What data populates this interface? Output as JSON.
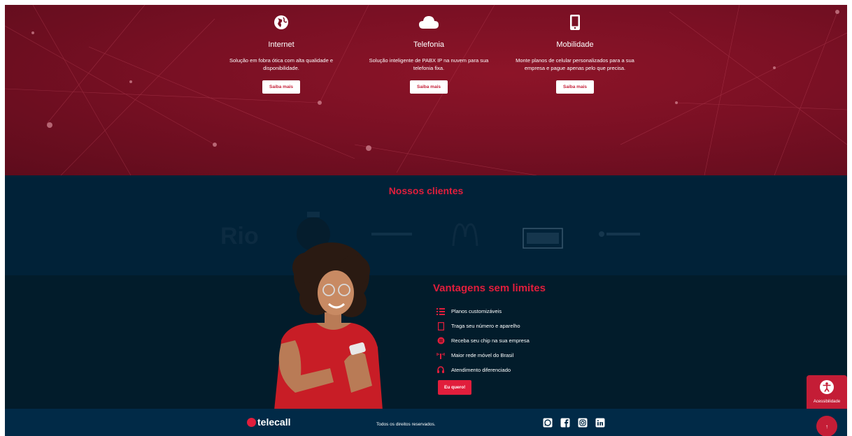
{
  "services": [
    {
      "icon": "globe-icon",
      "title": "Internet",
      "description": "Solução em fobra ótica com alta qualidade e disponibilidade.",
      "button": "Saiba mais"
    },
    {
      "icon": "cloud-icon",
      "title": "Telefonia",
      "description": "Solução inteligente de PABX IP na nuvem para sua telefonia fixa.",
      "button": "Saiba mais"
    },
    {
      "icon": "mobile-phone-icon",
      "title": "Mobilidade",
      "description": "Monte planos de celular personalizados para a sua empresa e pague apenas pelo que precisa.",
      "button": "Saiba mais"
    }
  ],
  "clients": {
    "title": "Nossos clientes",
    "logos": [
      "rio-logo",
      "round-logo",
      "text-logo",
      "mcdonalds-logo",
      "box-logo",
      "small-text-logo"
    ]
  },
  "advantages": {
    "title": "Vantagens sem limites",
    "items": [
      {
        "icon": "list-icon",
        "label": "Planos customizáveis"
      },
      {
        "icon": "smartphone-icon",
        "label": "Traga seu número e aparelho"
      },
      {
        "icon": "chip-icon",
        "label": "Receba seu chip na sua empresa"
      },
      {
        "icon": "antenna-icon",
        "label": "Maior rede móvel do Brasil"
      },
      {
        "icon": "headset-icon",
        "label": "Atendimento diferenciado"
      }
    ],
    "cta": "Eu quero!"
  },
  "footer": {
    "brand": "telecall",
    "rights": "Todos os direitos reservados.",
    "social": [
      "whatsapp-icon",
      "facebook-icon",
      "instagram-icon",
      "linkedin-icon"
    ]
  },
  "accessibility": {
    "label": "Acessibilidade"
  },
  "colors": {
    "accent": "#e11e3c",
    "hero_bg": "#7a1024",
    "navy": "#012238"
  }
}
